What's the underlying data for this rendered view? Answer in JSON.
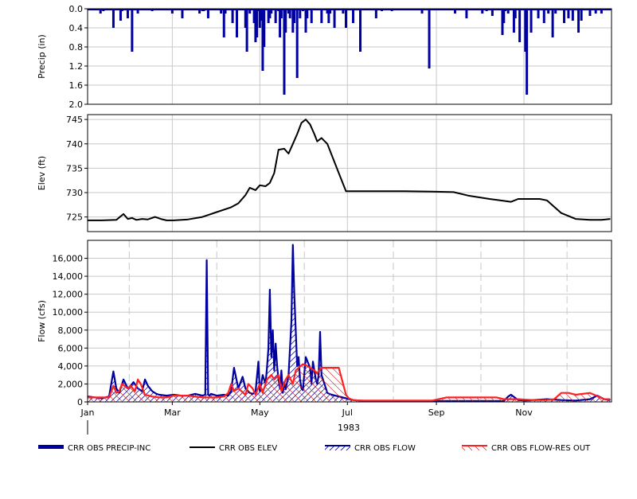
{
  "chart_data": [
    {
      "id": "precip",
      "type": "bar",
      "ylabel": "Precip (in)",
      "y_inverted": true,
      "ylim": [
        0,
        2.0
      ],
      "yticks": [
        "0.0",
        "0.4",
        "0.8",
        "1.2",
        "1.6",
        "2.0"
      ],
      "ytick_values": [
        0,
        0.4,
        0.8,
        1.2,
        1.6,
        2.0
      ],
      "series": [
        {
          "name": "CRR OBS PRECIP-INC",
          "color": "#0000a0",
          "x_day": [
            9,
            11,
            18,
            23,
            24,
            28,
            31,
            35,
            45,
            59,
            66,
            78,
            80,
            81,
            84,
            93,
            95,
            96,
            101,
            104,
            110,
            111,
            113,
            116,
            117,
            118,
            119,
            120,
            121,
            122,
            123,
            126,
            127,
            128,
            131,
            133,
            134,
            135,
            137,
            138,
            140,
            141,
            143,
            144,
            146,
            148,
            150,
            152,
            153,
            156,
            163,
            167,
            168,
            169,
            172,
            178,
            180,
            185,
            190,
            201,
            205,
            212,
            233,
            238,
            256,
            264,
            275,
            278,
            282,
            289,
            290,
            291,
            293,
            297,
            298,
            301,
            305,
            306,
            309,
            314,
            318,
            321,
            324,
            326,
            332,
            335,
            338,
            342,
            344,
            350,
            354,
            358
          ],
          "values": [
            0.1,
            0.05,
            0.4,
            0.25,
            0.05,
            0.2,
            0.9,
            0.1,
            0.05,
            0.1,
            0.2,
            0.1,
            0.05,
            0.05,
            0.2,
            0.1,
            0.6,
            0.1,
            0.3,
            0.6,
            0.4,
            0.9,
            0.1,
            0.3,
            0.7,
            0.6,
            0.05,
            0.4,
            0.25,
            1.3,
            0.8,
            0.3,
            0.2,
            0.1,
            0.3,
            0.05,
            0.6,
            0.2,
            1.8,
            0.5,
            0.1,
            0.2,
            0.5,
            0.3,
            1.45,
            0.2,
            0.05,
            0.5,
            0.2,
            0.3,
            0.3,
            0.1,
            0.3,
            0.1,
            0.4,
            0.1,
            0.4,
            0.3,
            0.9,
            0.2,
            0.05,
            0.05,
            0.1,
            1.25,
            0.1,
            0.2,
            0.1,
            0.05,
            0.15,
            0.55,
            0.3,
            0.05,
            0.1,
            0.5,
            0.2,
            0.7,
            0.9,
            1.8,
            0.5,
            0.2,
            0.3,
            0.1,
            0.6,
            0.1,
            0.3,
            0.2,
            0.25,
            0.5,
            0.25,
            0.15,
            0.1,
            0.1,
            0.6,
            0.1,
            0.2,
            0.05
          ]
        }
      ]
    },
    {
      "id": "elev",
      "type": "line",
      "ylabel": "Elev (ft)",
      "ylim": [
        722,
        746
      ],
      "yticks": [
        "725",
        "730",
        "735",
        "740",
        "745"
      ],
      "ytick_values": [
        725,
        730,
        735,
        740,
        745
      ],
      "series": [
        {
          "name": "CRR OBS ELEV",
          "color": "#000000",
          "x_day": [
            0,
            10,
            20,
            25,
            28,
            31,
            34,
            38,
            42,
            47,
            51,
            55,
            60,
            70,
            80,
            90,
            100,
            105,
            110,
            113,
            117,
            120,
            124,
            127,
            130,
            133,
            137,
            140,
            143,
            146,
            149,
            152,
            155,
            158,
            160,
            163,
            167,
            171,
            175,
            180,
            185,
            190,
            200,
            220,
            240,
            255,
            265,
            280,
            290,
            295,
            300,
            310,
            315,
            320,
            330,
            340,
            350,
            358,
            364
          ],
          "values": [
            724.3,
            724.3,
            724.4,
            725.6,
            724.6,
            724.8,
            724.4,
            724.6,
            724.5,
            725.0,
            724.6,
            724.3,
            724.3,
            724.5,
            725.0,
            726.0,
            727.0,
            727.8,
            729.5,
            731.0,
            730.5,
            731.5,
            731.3,
            732.0,
            734.0,
            738.8,
            739.0,
            738.0,
            740.0,
            742.0,
            744.3,
            745.0,
            744.0,
            742.0,
            740.5,
            741.2,
            740.0,
            737.0,
            734.0,
            730.3,
            730.3,
            730.3,
            730.3,
            730.3,
            730.2,
            730.1,
            729.4,
            728.7,
            728.3,
            728.1,
            728.7,
            728.7,
            728.7,
            728.4,
            725.8,
            724.6,
            724.4,
            724.4,
            724.6
          ]
        }
      ]
    },
    {
      "id": "flow",
      "type": "line",
      "ylabel": "Flow (cfs)",
      "ylim": [
        0,
        18000
      ],
      "yticks": [
        "0",
        "2,000",
        "4,000",
        "6,000",
        "8,000",
        "10,000",
        "12,000",
        "14,000",
        "16,000"
      ],
      "ytick_values": [
        0,
        2000,
        4000,
        6000,
        8000,
        10000,
        12000,
        14000,
        16000
      ],
      "xticks": [
        "Jan",
        "Mar",
        "May",
        "Jul",
        "Sep",
        "Nov"
      ],
      "xtick_days": [
        0,
        59,
        120,
        181,
        243,
        304
      ],
      "year_label": "1983",
      "series": [
        {
          "name": "CRR OBS FLOW",
          "color": "#0000a0",
          "hatch": true,
          "x_day": [
            0,
            5,
            10,
            15,
            18,
            20,
            22,
            25,
            28,
            30,
            32,
            35,
            38,
            40,
            42,
            45,
            48,
            50,
            55,
            60,
            65,
            70,
            75,
            80,
            82,
            83,
            84,
            85,
            86,
            90,
            95,
            98,
            100,
            102,
            105,
            108,
            110,
            113,
            115,
            117,
            119,
            120,
            121,
            122,
            123,
            124,
            125,
            126,
            127,
            128,
            129,
            130,
            131,
            132,
            133,
            134,
            135,
            136,
            137,
            138,
            140,
            142,
            143,
            144,
            145,
            146,
            147,
            148,
            149,
            150,
            152,
            155,
            156,
            157,
            158,
            159,
            160,
            161,
            162,
            163,
            165,
            167,
            170,
            175,
            180,
            182,
            185,
            190,
            195,
            200,
            210,
            220,
            230,
            240,
            250,
            260,
            270,
            280,
            290,
            293,
            295,
            300,
            305,
            310,
            320,
            330,
            340,
            350,
            355,
            360,
            364
          ],
          "values": [
            600,
            500,
            400,
            600,
            3400,
            1500,
            1000,
            2500,
            1500,
            1800,
            2200,
            1500,
            1200,
            2500,
            1800,
            1200,
            900,
            800,
            700,
            800,
            700,
            700,
            900,
            700,
            800,
            15800,
            800,
            700,
            900,
            700,
            800,
            700,
            1200,
            3800,
            1500,
            2800,
            1500,
            1000,
            900,
            1100,
            4500,
            1200,
            2000,
            3000,
            2500,
            2000,
            3800,
            6000,
            12500,
            5000,
            8000,
            3500,
            6500,
            4000,
            2500,
            1500,
            3500,
            1000,
            2200,
            1400,
            3000,
            9000,
            17500,
            12000,
            8000,
            4000,
            5000,
            2500,
            1500,
            1300,
            5000,
            3800,
            2000,
            4500,
            3500,
            2500,
            2000,
            3000,
            7800,
            3000,
            2000,
            1000,
            800,
            600,
            400,
            300,
            200,
            150,
            100,
            100,
            100,
            100,
            100,
            100,
            100,
            100,
            100,
            100,
            100,
            600,
            800,
            200,
            150,
            200,
            300,
            200,
            150,
            300,
            700,
            300,
            200
          ]
        },
        {
          "name": "CRR OBS FLOW-RES OUT",
          "color": "#ff2020",
          "hatch": true,
          "x_day": [
            0,
            15,
            18,
            20,
            22,
            24,
            28,
            30,
            33,
            35,
            37,
            40,
            45,
            50,
            55,
            60,
            70,
            80,
            90,
            95,
            98,
            100,
            102,
            105,
            110,
            112,
            115,
            117,
            120,
            122,
            125,
            128,
            130,
            133,
            135,
            138,
            140,
            143,
            145,
            147,
            150,
            152,
            155,
            158,
            160,
            163,
            165,
            170,
            175,
            178,
            180,
            182,
            185,
            190,
            200,
            220,
            230,
            240,
            250,
            255,
            260,
            270,
            285,
            290,
            300,
            310,
            320,
            325,
            330,
            335,
            340,
            350,
            360,
            364
          ],
          "values": [
            500,
            500,
            1800,
            1000,
            1200,
            2000,
            1500,
            1800,
            1200,
            2500,
            2000,
            800,
            600,
            500,
            500,
            700,
            700,
            500,
            500,
            600,
            1000,
            2000,
            1200,
            1500,
            800,
            2000,
            1500,
            800,
            2000,
            1000,
            2500,
            3000,
            2500,
            3000,
            1200,
            2500,
            3000,
            2000,
            3500,
            3800,
            4200,
            4100,
            3800,
            3500,
            3200,
            3800,
            3800,
            3800,
            3800,
            2000,
            800,
            400,
            200,
            150,
            150,
            150,
            150,
            150,
            500,
            500,
            500,
            500,
            500,
            300,
            300,
            200,
            200,
            300,
            1000,
            1000,
            800,
            1000,
            300,
            300
          ]
        }
      ]
    }
  ],
  "legend": [
    {
      "label": "CRR OBS PRECIP-INC",
      "style": "thick-bar",
      "color": "#0000a0"
    },
    {
      "label": "CRR OBS ELEV",
      "style": "line",
      "color": "#000000"
    },
    {
      "label": "CRR OBS FLOW",
      "style": "hatch",
      "color": "#0000a0"
    },
    {
      "label": "CRR OBS FLOW-RES OUT",
      "style": "hatch",
      "color": "#ff2020"
    }
  ]
}
